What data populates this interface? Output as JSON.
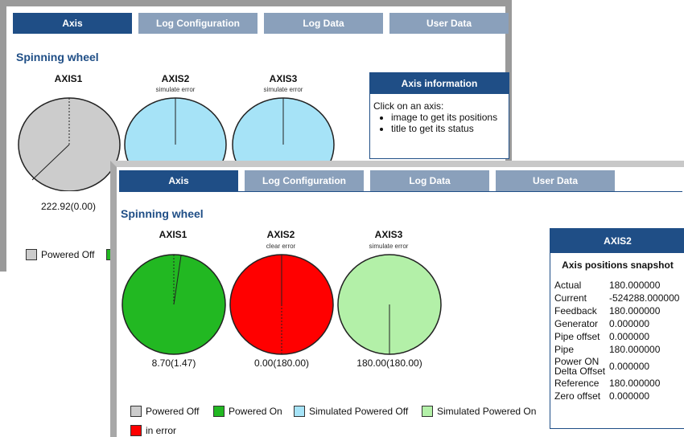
{
  "back_window": {
    "tabs": [
      "Axis",
      "Log Configuration",
      "Log Data",
      "User Data"
    ],
    "section_title": "Spinning wheel",
    "axes": [
      {
        "title": "AXIS1",
        "subtitle": "",
        "value": "222.92(0.00)"
      },
      {
        "title": "AXIS2",
        "subtitle": "simulate error",
        "value": ""
      },
      {
        "title": "AXIS3",
        "subtitle": "simulate error",
        "value": ""
      }
    ],
    "info": {
      "title": "Axis information",
      "intro": "Click on an axis:",
      "items": [
        "image to get its positions",
        "title to get its status"
      ]
    },
    "legend_partial": "Powered Off"
  },
  "front_window": {
    "tabs": [
      "Axis",
      "Log Configuration",
      "Log Data",
      "User Data"
    ],
    "section_title": "Spinning wheel",
    "axes": [
      {
        "title": "AXIS1",
        "subtitle": "",
        "value": "8.70(1.47)"
      },
      {
        "title": "AXIS2",
        "subtitle": "clear error",
        "value": "0.00(180.00)"
      },
      {
        "title": "AXIS3",
        "subtitle": "simulate error",
        "value": "180.00(180.00)"
      }
    ],
    "legend": [
      {
        "label": "Powered Off",
        "color": "#cccccc"
      },
      {
        "label": "Powered On",
        "color": "#22b822"
      },
      {
        "label": "Simulated Powered Off",
        "color": "#a6e3f7"
      },
      {
        "label": "Simulated Powered On",
        "color": "#b3f0a8"
      },
      {
        "label": "in error",
        "color": "#ff0000"
      }
    ],
    "snapshot": {
      "title": "AXIS2",
      "subtitle": "Axis positions snapshot",
      "rows": [
        {
          "k": "Actual",
          "v": "180.000000"
        },
        {
          "k": "Current",
          "v": "-524288.000000"
        },
        {
          "k": "Feedback",
          "v": "180.000000"
        },
        {
          "k": "Generator",
          "v": "0.000000"
        },
        {
          "k": "Pipe offset",
          "v": "0.000000"
        },
        {
          "k": "Pipe",
          "v": "180.000000"
        },
        {
          "k": "Power ON Delta Offset",
          "v": "0.000000"
        },
        {
          "k": "Reference",
          "v": "180.000000"
        },
        {
          "k": "Zero offset",
          "v": "0.000000"
        }
      ]
    }
  },
  "colors": {
    "accent": "#1f4e86",
    "tab_inactive": "#8aa0bb",
    "powered_off": "#cccccc",
    "powered_on": "#22b822",
    "sim_off": "#a6e3f7",
    "sim_on": "#b3f0a8",
    "error": "#ff0000"
  }
}
